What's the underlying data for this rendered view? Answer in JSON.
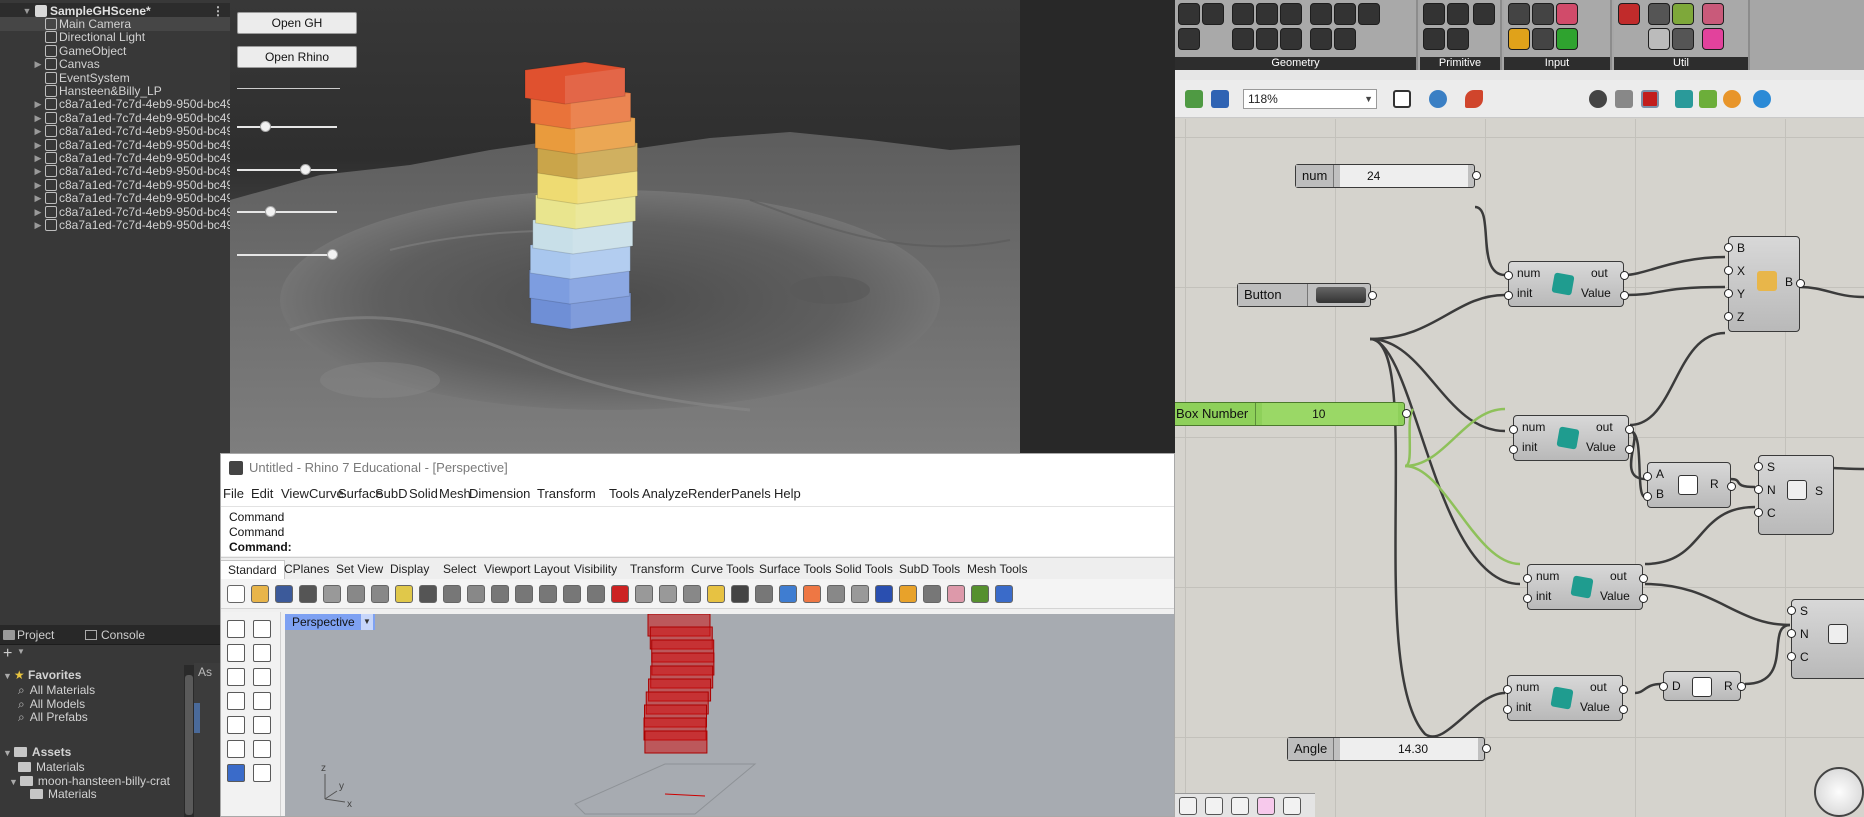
{
  "unity": {
    "hierarchy": {
      "scene": "SampleGHScene*",
      "items": [
        {
          "label": "Main Camera",
          "has_arrow": false,
          "selected": true
        },
        {
          "label": "Directional Light",
          "has_arrow": false
        },
        {
          "label": "GameObject",
          "has_arrow": false
        },
        {
          "label": "Canvas",
          "has_arrow": true
        },
        {
          "label": "EventSystem",
          "has_arrow": false
        },
        {
          "label": "Hansteen&Billy_LP",
          "has_arrow": false
        },
        {
          "label": "c8a7a1ed-7c7d-4eb9-950d-bc499",
          "has_arrow": true
        },
        {
          "label": "c8a7a1ed-7c7d-4eb9-950d-bc499",
          "has_arrow": true
        },
        {
          "label": "c8a7a1ed-7c7d-4eb9-950d-bc499",
          "has_arrow": true
        },
        {
          "label": "c8a7a1ed-7c7d-4eb9-950d-bc499",
          "has_arrow": true
        },
        {
          "label": "c8a7a1ed-7c7d-4eb9-950d-bc499",
          "has_arrow": true
        },
        {
          "label": "c8a7a1ed-7c7d-4eb9-950d-bc499",
          "has_arrow": true
        },
        {
          "label": "c8a7a1ed-7c7d-4eb9-950d-bc499",
          "has_arrow": true
        },
        {
          "label": "c8a7a1ed-7c7d-4eb9-950d-bc499",
          "has_arrow": true
        },
        {
          "label": "c8a7a1ed-7c7d-4eb9-950d-bc499",
          "has_arrow": true
        },
        {
          "label": "c8a7a1ed-7c7d-4eb9-950d-bc499",
          "has_arrow": true
        }
      ]
    },
    "game": {
      "open_gh": "Open GH",
      "open_rhino": "Open Rhino",
      "sliders": [
        0.28,
        0.68,
        0.33,
        0.95
      ],
      "tower_colors": [
        "#6f8fd6",
        "#7d9de0",
        "#a9c7ee",
        "#c8dfe8",
        "#e9e58e",
        "#eedb72",
        "#caa54a",
        "#e99b3d",
        "#e9733a",
        "#e0512f"
      ]
    },
    "project": {
      "tabs": {
        "project": "Project",
        "console": "Console"
      },
      "add": "+",
      "favorites": {
        "label": "Favorites",
        "items": [
          "All Materials",
          "All Models",
          "All Prefabs"
        ]
      },
      "assets": {
        "label": "Assets",
        "items": [
          "Materials",
          "moon-hansteen-billy-crat",
          "Materials"
        ]
      },
      "right_label": "As"
    }
  },
  "rhino": {
    "title": "Untitled - Rhino 7 Educational - [Perspective]",
    "menu": [
      "File",
      "Edit",
      "View",
      "Curve",
      "Surface",
      "SubD",
      "Solid",
      "Mesh",
      "Dimension",
      "Transform",
      "Tools",
      "Analyze",
      "Render",
      "Panels",
      "Help"
    ],
    "command_lines": [
      "Command",
      "Command",
      "Command:"
    ],
    "tabs": [
      "Standard",
      "CPlanes",
      "Set View",
      "Display",
      "Select",
      "Viewport Layout",
      "Visibility",
      "Transform",
      "Curve Tools",
      "Surface Tools",
      "Solid Tools",
      "SubD Tools",
      "Mesh Tools"
    ],
    "viewport_label": "Perspective",
    "axes": {
      "z": "z",
      "y": "y",
      "x": "x"
    }
  },
  "grasshopper": {
    "groups": [
      "Geometry",
      "Primitive",
      "Input",
      "Util"
    ],
    "zoom": "118%",
    "sliders": {
      "num": {
        "name": "num",
        "value": "24",
        "fraction": 0.3
      },
      "box_number": {
        "name": "Box Number",
        "value": "10",
        "fraction": 0.45
      },
      "angle": {
        "name": "Angle",
        "value": "14.30",
        "fraction": 0.5
      }
    },
    "button": {
      "name": "Button"
    },
    "script_params": {
      "num": "num",
      "init": "init",
      "out": "out",
      "value": "Value"
    },
    "box_params": [
      "B",
      "X",
      "Y",
      "Z",
      "B"
    ],
    "mult_params": [
      "A",
      "B",
      "R"
    ],
    "series_params": [
      "S",
      "N",
      "C",
      "S"
    ],
    "series2_params": [
      "S",
      "N",
      "C"
    ],
    "radians_params": [
      "D",
      "R"
    ]
  }
}
